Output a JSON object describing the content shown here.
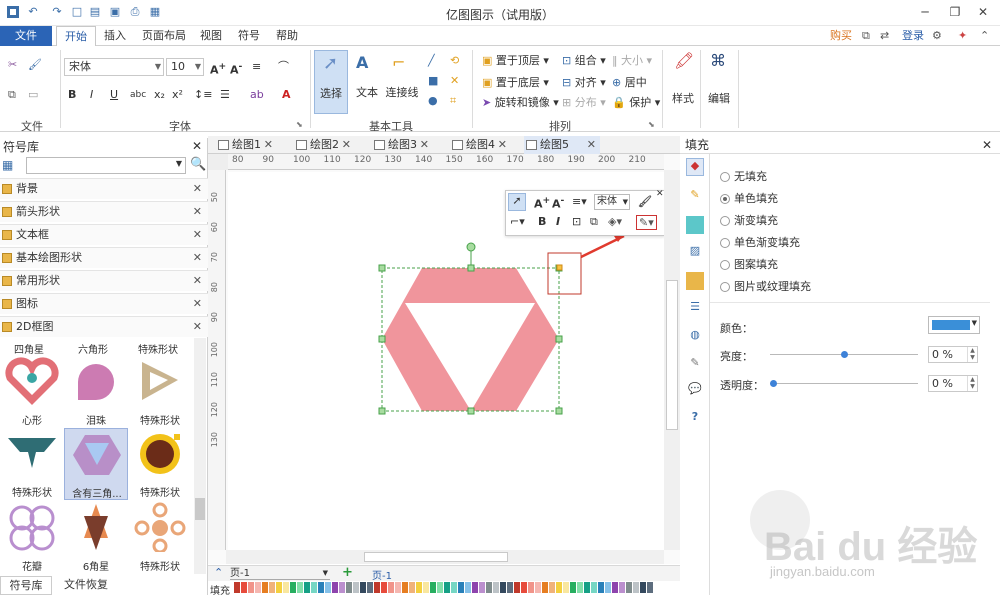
{
  "window": {
    "title": "亿图图示（试用版）"
  },
  "menu": {
    "items": [
      "文件",
      "开始",
      "插入",
      "页面布局",
      "视图",
      "符号",
      "帮助"
    ],
    "right": {
      "buy": "购买",
      "login": "登录"
    }
  },
  "ribbon": {
    "font_name": "宋体",
    "font_size": "10",
    "groups": {
      "file": "文件",
      "font": "字体",
      "basic_tools": "基本工具",
      "arrange": "排列"
    },
    "tools": {
      "select": "选择",
      "text": "文本",
      "connector": "连接线"
    },
    "arrange": {
      "bring_top": "置于顶层",
      "send_bottom": "置于底层",
      "rotate_mirror": "旋转和镜像",
      "group": "组合",
      "align": "对齐",
      "distribute": "分布",
      "size": "大小",
      "center": "居中",
      "protect": "保护"
    },
    "style": "样式",
    "edit": "编辑"
  },
  "left_panel": {
    "title": "符号库",
    "categories": [
      "背景",
      "箭头形状",
      "文本框",
      "基本绘图形状",
      "常用形状",
      "图标",
      "2D框图"
    ],
    "top_labels": [
      "四角星",
      "六角形",
      "特殊形状"
    ],
    "shapes": [
      {
        "label": "心形",
        "color": "#e26f76"
      },
      {
        "label": "泪珠",
        "color": "#cc7bb2"
      },
      {
        "label": "特殊形状",
        "color": "#c9b48f"
      },
      {
        "label": "特殊形状",
        "color": "#2f6d74"
      },
      {
        "label": "含有三角...",
        "color": "#b88fc8"
      },
      {
        "label": "特殊形状",
        "color": "#6b2c18"
      },
      {
        "label": "花瓣",
        "color": "#b98fcf"
      },
      {
        "label": "6角星",
        "color": "#e78a50"
      },
      {
        "label": "特殊形状",
        "color": "#e9a678"
      }
    ],
    "bottom_tabs": [
      "符号库",
      "文件恢复"
    ]
  },
  "doc_tabs": [
    "绘图1",
    "绘图2",
    "绘图3",
    "绘图4",
    "绘图5"
  ],
  "ruler_h": [
    "80",
    "90",
    "100",
    "110",
    "120",
    "130",
    "140",
    "150",
    "160",
    "170",
    "180",
    "190",
    "200",
    "210"
  ],
  "ruler_v": [
    "50",
    "60",
    "70",
    "80",
    "90",
    "100",
    "110",
    "120",
    "130"
  ],
  "canvas": {
    "shape_color": "#f0959c",
    "selection_color": "#47a14a"
  },
  "minitool": {
    "font": "宋体"
  },
  "pagebar": {
    "page_select": "页-1",
    "page_tab": "页-1",
    "fill_label": "填充"
  },
  "fill_panel": {
    "title": "填充",
    "options": [
      "无填充",
      "单色填充",
      "渐变填充",
      "单色渐变填充",
      "图案填充",
      "图片或纹理填充"
    ],
    "selected": "单色填充",
    "color_label": "颜色：",
    "color_value": "#3a8fd8",
    "brightness_label": "亮度：",
    "brightness_value": "0 %",
    "transparency_label": "透明度：",
    "transparency_value": "0 %"
  },
  "watermark": {
    "text": "Bai du 经验",
    "sub": "jingyan.baidu.com"
  }
}
